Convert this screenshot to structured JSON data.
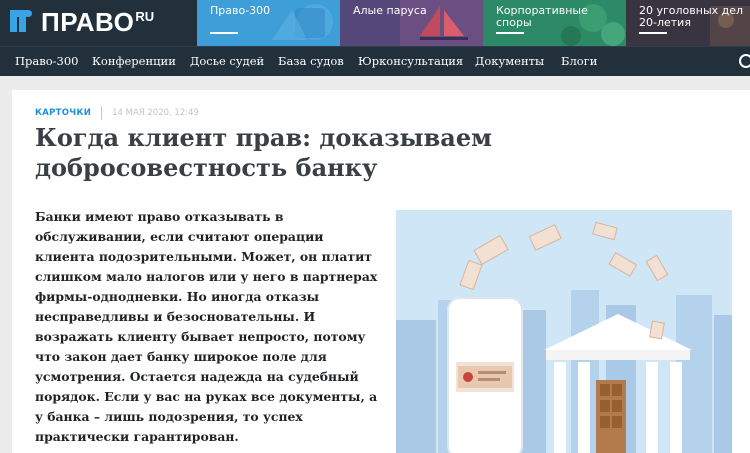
{
  "site": {
    "logo_text": "ПРАВО",
    "logo_suffix": "RU"
  },
  "promos": [
    {
      "label": "Право-300",
      "bg": "#3c9bd6"
    },
    {
      "label": "Алые паруса",
      "bg": "#5a4a7e"
    },
    {
      "label": "Корпоративные споры",
      "bg": "#2f8f6a"
    },
    {
      "label": "20 уголовных дел 20-летия",
      "bg": "#3a3540"
    }
  ],
  "nav": [
    "Право-300",
    "Конференции",
    "Досье судей",
    "База судов",
    "Юрконсультация",
    "Документы",
    "Блоги"
  ],
  "article": {
    "category": "КАРТОЧКИ",
    "date": "14 МАЯ 2020, 12:49",
    "title": "Когда клиент прав: доказываем добросовестность банку",
    "lead": "Банки имеют право отказывать в обслуживании, если считают операции клиента подозрительными. Может, он платит слишком мало налогов или у него в партнерах фирмы-однодневки. Но иногда отказы несправедливы и безосновательны. И возражать клиенту бывает непросто, потому что закон дает банку широкое поле для усмотрения. Остается надежда на судебный порядок. Если у вас на руках все документы, а у банка – лишь подозрения, то успех практически гарантирован."
  },
  "colors": {
    "header_bg": "#22303c",
    "accent": "#1e8fdc",
    "title": "#3a3f44"
  },
  "icons": [
    "logo-icon",
    "search-icon"
  ]
}
